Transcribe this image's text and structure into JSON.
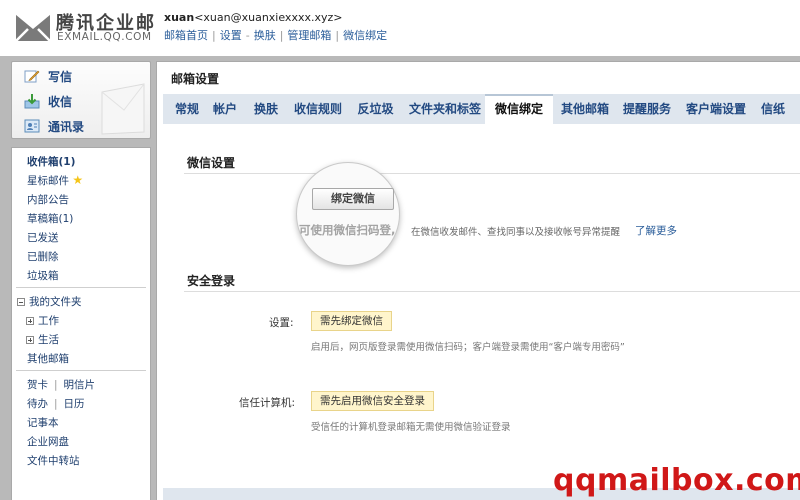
{
  "logo": {
    "cn": "腾讯企业邮",
    "en": "EXMAIL.QQ.COM"
  },
  "user": {
    "name": "xuan",
    "email": "<xuan@xuanxiexxxx.xyz>",
    "links": [
      "邮箱首页",
      "设置",
      "换肤",
      "管理邮箱",
      "微信绑定"
    ],
    "dash": "-",
    "bar": "|"
  },
  "quick": {
    "write": "写信",
    "inbox": "收信",
    "contacts": "通讯录"
  },
  "folders": {
    "inbox": "收件箱(1)",
    "starred": "星标邮件",
    "notice": "内部公告",
    "drafts": "草稿箱(1)",
    "sent": "已发送",
    "deleted": "已删除",
    "spam": "垃圾箱",
    "my_folders": "我的文件夹",
    "work": "工作",
    "life": "生活",
    "other": "其他邮箱",
    "card": "贺卡",
    "postcard": "明信片",
    "todo": "待办",
    "calendar": "日历",
    "notes": "记事本",
    "disk": "企业网盘",
    "transfer": "文件中转站",
    "sep": "|"
  },
  "main": {
    "title": "邮箱设置",
    "tabs": [
      "常规",
      "帐户",
      "换肤",
      "收信规则",
      "反垃圾",
      "文件夹和标签",
      "微信绑定",
      "其他邮箱",
      "提醒服务",
      "客户端设置",
      "信纸"
    ],
    "active_tab": "微信绑定",
    "wechat": {
      "title": "微信设置",
      "bind_button": "绑定微信",
      "desc_a": "可使用微信扫码登,",
      "desc_b": "在微信收发邮件、查找同事以及接收帐号异常提醒",
      "learn_more": "了解更多"
    },
    "security": {
      "title": "安全登录",
      "setting_label": "设置:",
      "setting_button": "需先绑定微信",
      "setting_hint": "启用后，网页版登录需使用微信扫码；客户端登录需使用“客户端专用密码”",
      "trusted_label": "信任计算机:",
      "trusted_button": "需先启用微信安全登录",
      "trusted_hint": "受信任的计算机登录邮箱无需使用微信验证登录"
    }
  },
  "watermark": "qqmailbox.com",
  "colors": {
    "link": "#2a5d9a",
    "frame": "#b9b9b9",
    "tab_bar": "#dfe6ee",
    "warn_bg": "#fff5cc",
    "watermark": "#d01818",
    "star": "#f5c518"
  }
}
